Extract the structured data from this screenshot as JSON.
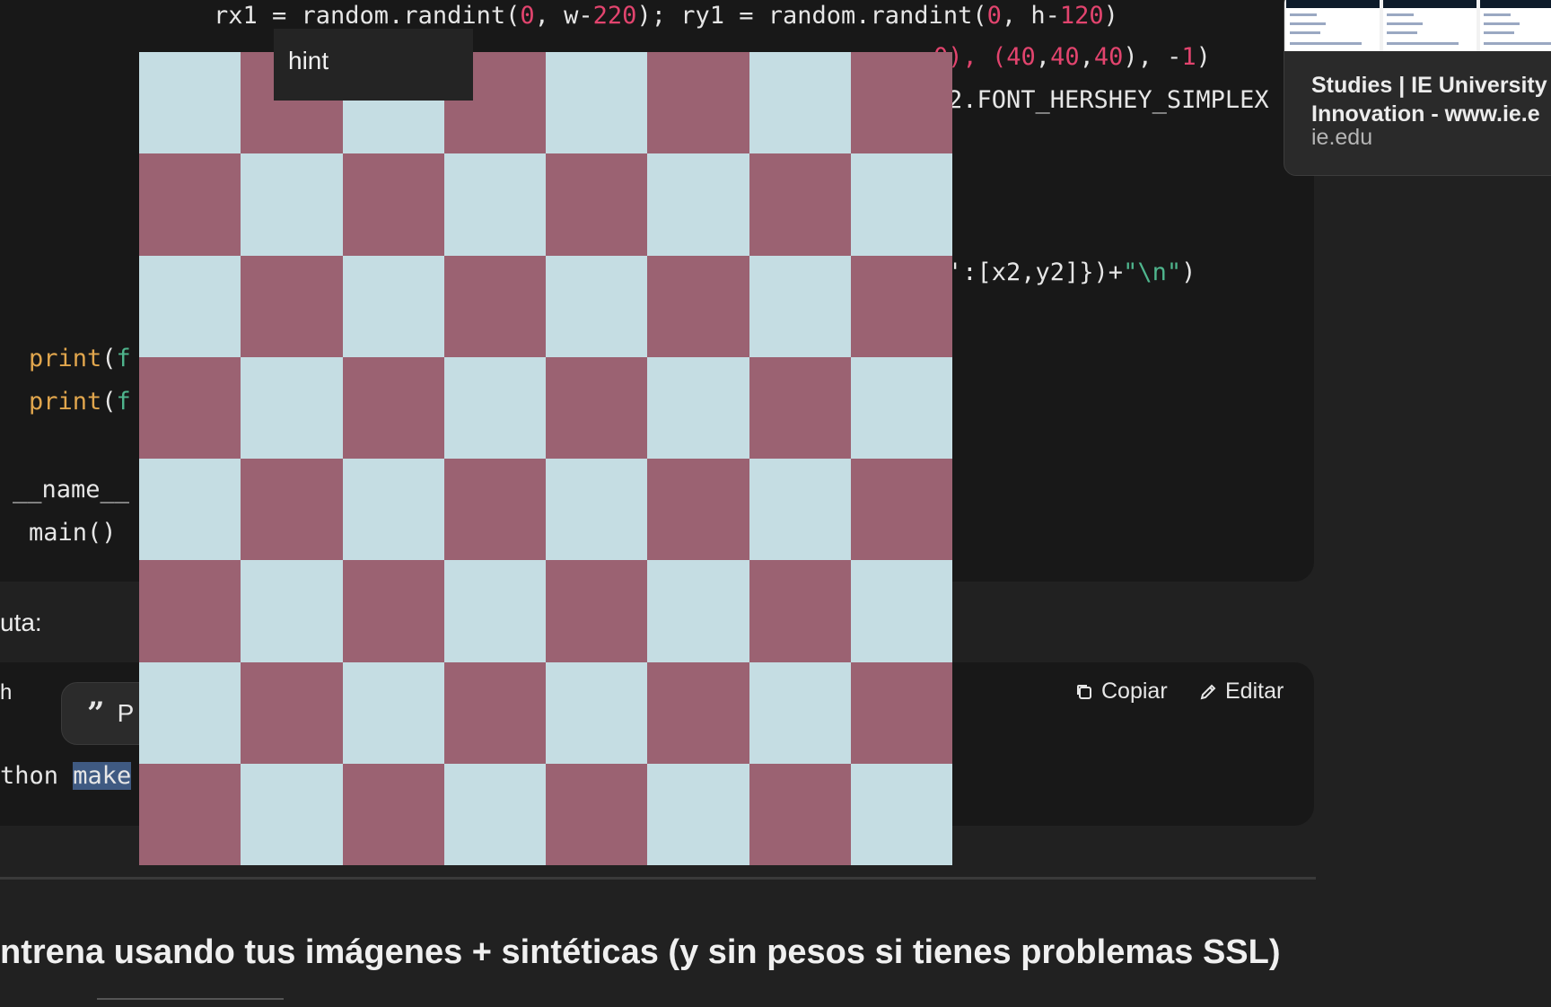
{
  "code": {
    "line1": {
      "a": "rx1 = random.randint(",
      "n1": "0",
      "b": ", w-",
      "n2": "220",
      "c": "); ry1 = random.randint(",
      "n3": "0",
      "d": ", h-",
      "n4": "120",
      "e": ")"
    },
    "line2": {
      "a": "0), (",
      "n1": "40",
      "b": ",",
      "n2": "40",
      "c": ",",
      "n3": "40",
      "d": "), -",
      "n4": "1",
      "e": ")"
    },
    "line3": "2.FONT_HERSHEY_SIMPLEX",
    "line4": {
      "a": "':[x2,y2]})+",
      "s": "\"\\n\"",
      "b": ")"
    },
    "print1": {
      "fn": "print",
      "open": "(",
      "s": "f"
    },
    "print2": {
      "fn": "print",
      "open": "(",
      "s": "f"
    },
    "name_line": "__name__",
    "main_line": "main()"
  },
  "intro_text": "uta:",
  "console": {
    "lang_label": "h",
    "command_prefix": "thon ",
    "command_highlight": "make",
    "copy_label": "Copiar",
    "edit_label": "Editar",
    "quote_chip_text": "P"
  },
  "heading": "ntrena usando tus imágenes + sintéticas (y sin pesos si tienes problemas SSL)",
  "preview": {
    "title_line1": "Studies | IE University",
    "title_line2": "Innovation - www.ie.e",
    "domain": "ie.edu"
  },
  "tooltip": "hint",
  "board": {
    "rows": 8,
    "cols": 8,
    "light_color": "#c5dde3",
    "dark_color": "#9b6272"
  }
}
